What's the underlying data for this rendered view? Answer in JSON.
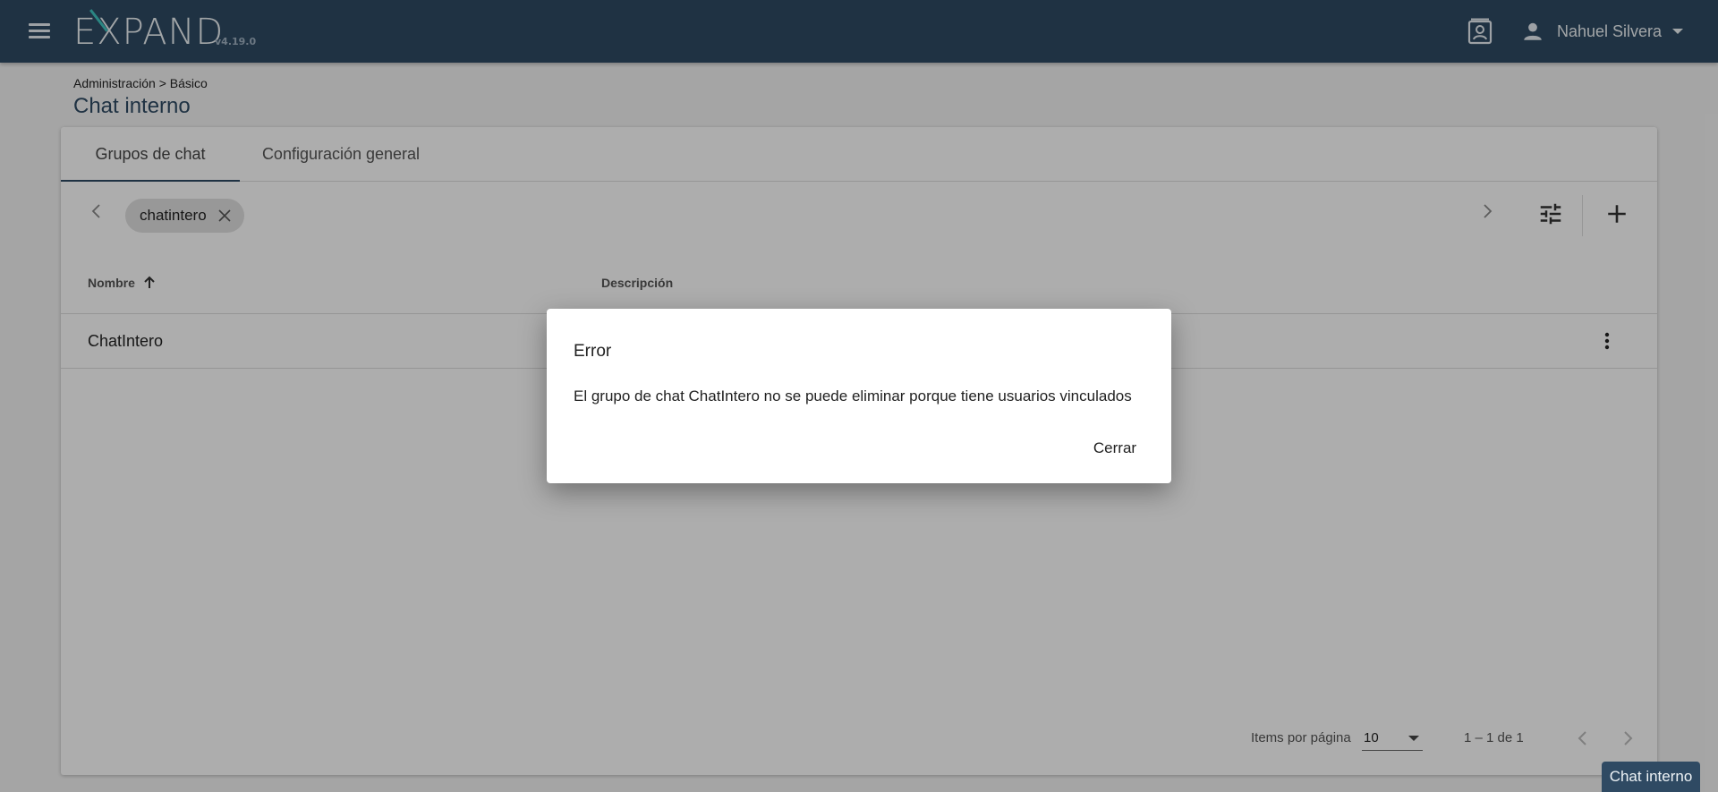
{
  "header": {
    "logo": "EXPAND",
    "version": "v4.19.0",
    "user_name": "Nahuel Silvera",
    "icons": {
      "menu": "menu-icon",
      "contacts": "contact-card-icon",
      "user": "person-icon",
      "dropdown": "caret-down-icon"
    },
    "color": "#2f4a63"
  },
  "breadcrumb": "Administración > Básico",
  "page_title": "Chat interno",
  "tabs": [
    {
      "label": "Grupos de chat",
      "active": true
    },
    {
      "label": "Configuración general",
      "active": false
    }
  ],
  "filter": {
    "chip_label": "chatintero",
    "icons": {
      "prev": "chevron-left-icon",
      "next": "chevron-right-icon",
      "filter": "tune-icon",
      "add": "plus-icon"
    }
  },
  "table": {
    "columns": [
      "Nombre",
      "Descripción"
    ],
    "sort": {
      "column": "Nombre",
      "direction": "ascending"
    },
    "rows": [
      {
        "nombre": "ChatIntero",
        "descripcion": ""
      }
    ]
  },
  "paginator": {
    "items_label": "Items por página",
    "page_size": "10",
    "range": "1 – 1 de 1"
  },
  "dialog": {
    "title": "Error",
    "message": "El grupo de chat ChatIntero no se puede eliminar porque tiene usuarios vinculados",
    "button": "Cerrar"
  },
  "chat_badge": "Chat interno"
}
